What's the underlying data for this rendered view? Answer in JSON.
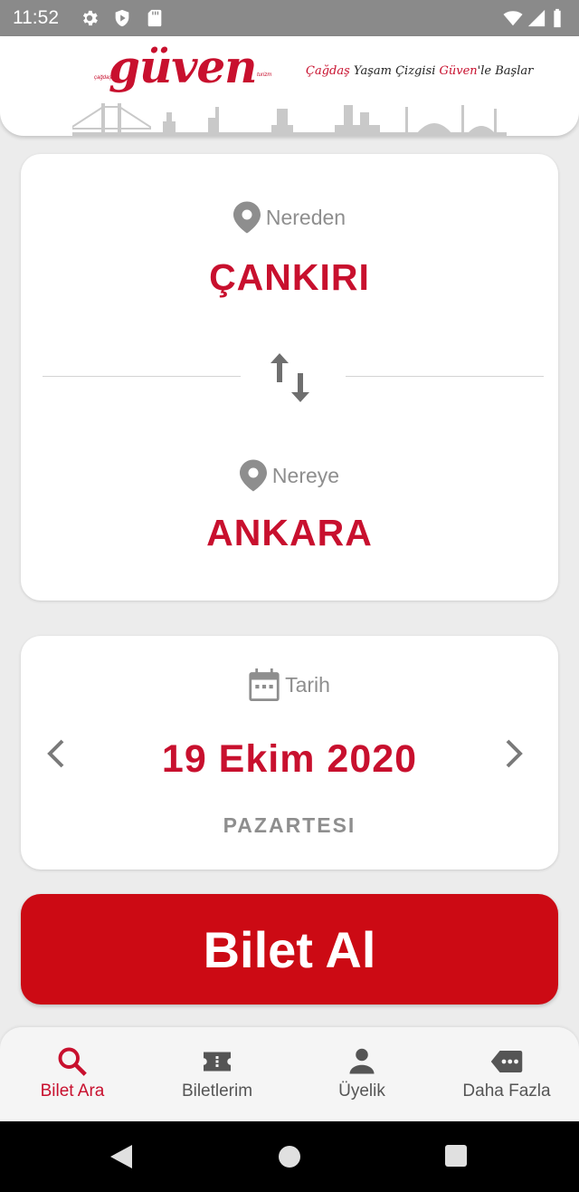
{
  "status_bar": {
    "time": "11:52",
    "icons": [
      "gear-icon",
      "shield-play-icon",
      "sd-card-icon",
      "wifi-icon",
      "signal-icon",
      "battery-icon"
    ]
  },
  "header": {
    "logo_text": "güven",
    "logo_small_left": "çağdaş",
    "logo_small_right": "turizm",
    "slogan_part1": "Çağdaş",
    "slogan_part2": " Yaşam Çizgisi ",
    "slogan_part3": "Güven",
    "slogan_part4": "'le Başlar"
  },
  "route": {
    "from_label": "Nereden",
    "from_value": "ÇANKIRI",
    "to_label": "Nereye",
    "to_value": "ANKARA",
    "swap_icon": "swap-vertical-icon"
  },
  "date_card": {
    "label": "Tarih",
    "date": "19 Ekim 2020",
    "day": "PAZARTESI",
    "prev_icon": "chevron-left-icon",
    "next_icon": "chevron-right-icon"
  },
  "actions": {
    "buy_label": "Bilet Al"
  },
  "bottom_nav": {
    "items": [
      {
        "label": "Bilet Ara",
        "icon": "search-icon",
        "active": true
      },
      {
        "label": "Biletlerim",
        "icon": "ticket-icon",
        "active": false
      },
      {
        "label": "Üyelik",
        "icon": "person-icon",
        "active": false
      },
      {
        "label": "Daha Fazla",
        "icon": "more-tag-icon",
        "active": false
      }
    ]
  },
  "colors": {
    "brand_red": "#c8102e",
    "button_red": "#cc0a14",
    "muted_text": "#8e8e8e",
    "background": "#ececec"
  }
}
